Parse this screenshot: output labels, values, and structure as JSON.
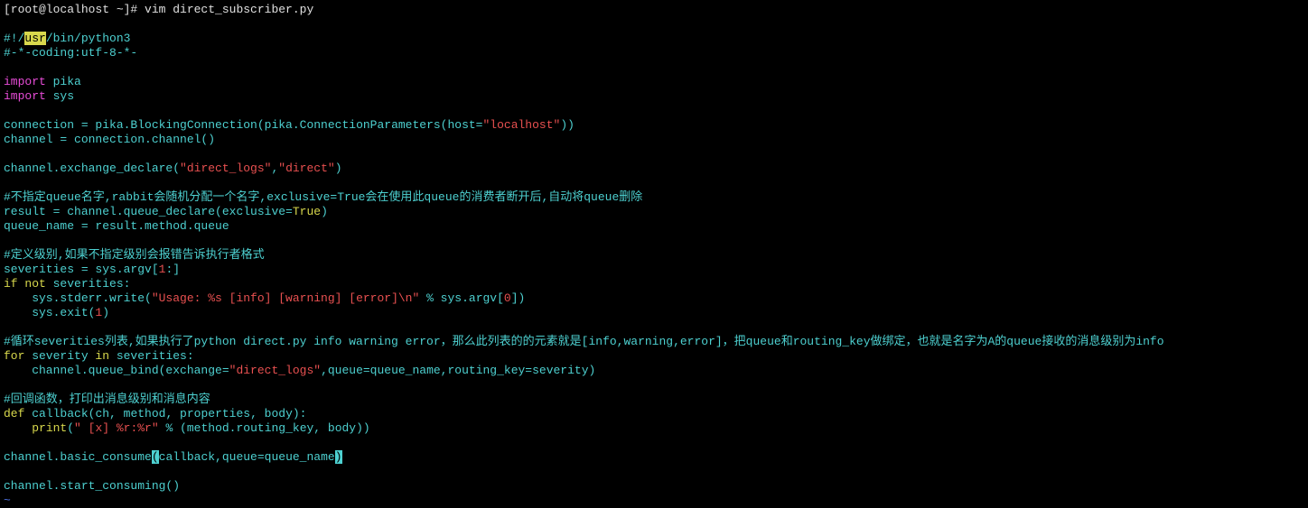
{
  "prompt": {
    "line": "[root@localhost ~]# vim direct_subscriber.py"
  },
  "l1": {
    "a": "#!/",
    "b": "usr",
    "c": "/bin/python3"
  },
  "l2": "#-*-coding:utf-8-*-",
  "l3": {
    "a": "import",
    "b": " pika"
  },
  "l4": {
    "a": "import",
    "b": " sys"
  },
  "l5": {
    "a": "connection = pika.BlockingConnection(pika.ConnectionParameters(host=",
    "b": "\"localhost\"",
    "c": "))"
  },
  "l6": "channel = connection.channel()",
  "l7": {
    "a": "channel.exchange_declare(",
    "b": "\"direct_logs\"",
    "c": ",",
    "d": "\"direct\"",
    "e": ")"
  },
  "l8": "#不指定queue名字,rabbit会随机分配一个名字,exclusive=True会在使用此queue的消费者断开后,自动将queue删除",
  "l9": {
    "a": "result = channel.queue_declare(exclusive=",
    "b": "True",
    "c": ")"
  },
  "l10": "queue_name = result.method.queue",
  "l11": "#定义级别,如果不指定级别会报错告诉执行者格式",
  "l12": {
    "a": "severities = sys.argv[",
    "b": "1",
    "c": ":]"
  },
  "l13": {
    "a": "if",
    "b": " ",
    "c": "not",
    "d": " severities:"
  },
  "l14": {
    "a": "    sys.stderr.write(",
    "b": "\"Usage: %s [info] [warning] [error]\\n\"",
    "c": " % sys.argv[",
    "d": "0",
    "e": "])"
  },
  "l15": {
    "a": "    sys.exit(",
    "b": "1",
    "c": ")"
  },
  "l16": "#循环severities列表,如果执行了python direct.py info warning error，那么此列表的的元素就是[info,warning,error]，把queue和routing_key做绑定，也就是名字为A的queue接收的消息级别为info",
  "l17": {
    "a": "for",
    "b": " severity ",
    "c": "in",
    "d": " severities:"
  },
  "l18": {
    "a": "    channel.queue_bind(exchange=",
    "b": "\"direct_logs\"",
    "c": ",queue=queue_name,routing_key=severity)"
  },
  "l19": "#回调函数，打印出消息级别和消息内容",
  "l20": {
    "a": "def",
    "b": " ",
    "c": "callback",
    "d": "(ch, method, properties, body):"
  },
  "l21": {
    "a": "    ",
    "b": "print",
    "c": "(",
    "d": "\" [x] %r:%r\"",
    "e": " % (method.routing_key, body))"
  },
  "l22": {
    "a": "channel.basic_consume",
    "b": "(",
    "c": "callback,queue=queue_name",
    "d": ")"
  },
  "l23": "channel.start_consuming()",
  "tilde": "~"
}
